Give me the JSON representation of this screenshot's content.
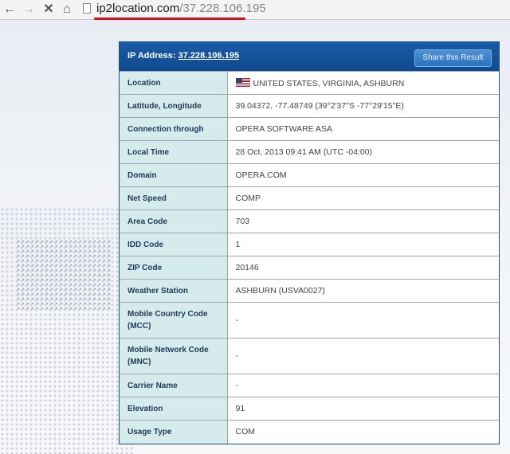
{
  "browser": {
    "url_domain": "ip2location.com",
    "url_path": "/37.228.106.195"
  },
  "header": {
    "ip_label": "IP Address:",
    "ip_value": "37.228.106.195",
    "share_label": "Share this Result"
  },
  "rows": [
    {
      "key": "Location",
      "value": "UNITED STATES, VIRGINIA, ASHBURN",
      "icon": "us-flag-icon"
    },
    {
      "key": "Latitude, Longitude",
      "value": "39.04372, -77.48749 (39°2'37\"S   -77°29'15\"E)"
    },
    {
      "key": "Connection through",
      "value": "OPERA SOFTWARE ASA"
    },
    {
      "key": "Local Time",
      "value": "28 Oct, 2013 09:41 AM (UTC -04:00)"
    },
    {
      "key": "Domain",
      "value": "OPERA.COM"
    },
    {
      "key": "Net Speed",
      "value": "COMP"
    },
    {
      "key": "Area Code",
      "value": "703"
    },
    {
      "key": "IDD Code",
      "value": "1"
    },
    {
      "key": "ZIP Code",
      "value": "20146"
    },
    {
      "key": "Weather Station",
      "value": "ASHBURN (USVA0027)"
    },
    {
      "key": "Mobile Country Code (MCC)",
      "value": "-"
    },
    {
      "key": "Mobile Network Code (MNC)",
      "value": "-"
    },
    {
      "key": "Carrier Name",
      "value": "-"
    },
    {
      "key": "Elevation",
      "value": "91"
    },
    {
      "key": "Usage Type",
      "value": "COM"
    }
  ]
}
